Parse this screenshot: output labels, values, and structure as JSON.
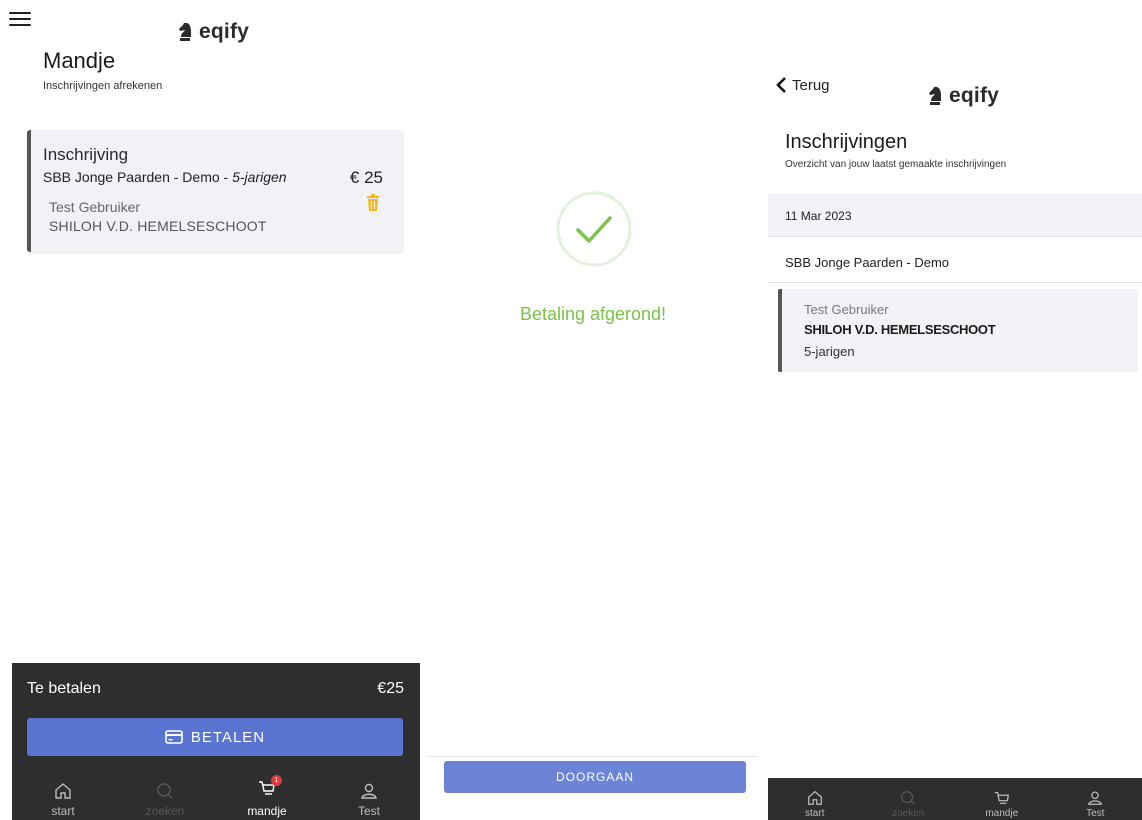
{
  "brand": {
    "name": "eqify"
  },
  "cart_screen": {
    "title": "Mandje",
    "subtitle": "Inschrijvingen afrekenen",
    "item": {
      "heading": "Inschrijving",
      "event": "SBB Jonge Paarden - Demo - ",
      "category": "5-jarigen",
      "price": "€ 25",
      "user": "Test Gebruiker",
      "horse": "SHILOH V.D. HEMELSESCHOOT"
    },
    "footer": {
      "total_label": "Te betalen",
      "total_amount": "€25",
      "pay_button": "BETALEN"
    },
    "nav": [
      {
        "label": "start",
        "icon": "home-icon",
        "state": "normal"
      },
      {
        "label": "zoeken",
        "icon": "search-icon",
        "state": "dim"
      },
      {
        "label": "mandje",
        "icon": "cart-icon",
        "state": "active",
        "badge": "1"
      },
      {
        "label": "Test",
        "icon": "user-icon",
        "state": "normal"
      }
    ]
  },
  "success_screen": {
    "message": "Betaling afgerond!",
    "continue_button": "DOORGAAN",
    "accent_color": "#7bc24a"
  },
  "entries_screen": {
    "back_label": "Terug",
    "title": "Inschrijvingen",
    "subtitle": "Overzicht van jouw laatst gemaakte inschrijvingen",
    "date": "11 Mar 2023",
    "event": "SBB Jonge Paarden - Demo",
    "entry": {
      "user": "Test Gebruiker",
      "horse": "SHILOH V.D. HEMELSESCHOOT",
      "category": "5-jarigen"
    },
    "nav": [
      {
        "label": "start",
        "icon": "home-icon",
        "state": "normal"
      },
      {
        "label": "zoeken",
        "icon": "search-icon",
        "state": "dim"
      },
      {
        "label": "mandje",
        "icon": "cart-icon",
        "state": "normal"
      },
      {
        "label": "Test",
        "icon": "user-icon",
        "state": "normal"
      }
    ]
  },
  "colors": {
    "primary_button": "#5a74d2",
    "dark_footer": "#2e2e2e",
    "trash_icon": "#f2b722",
    "badge": "#e23b3b"
  }
}
